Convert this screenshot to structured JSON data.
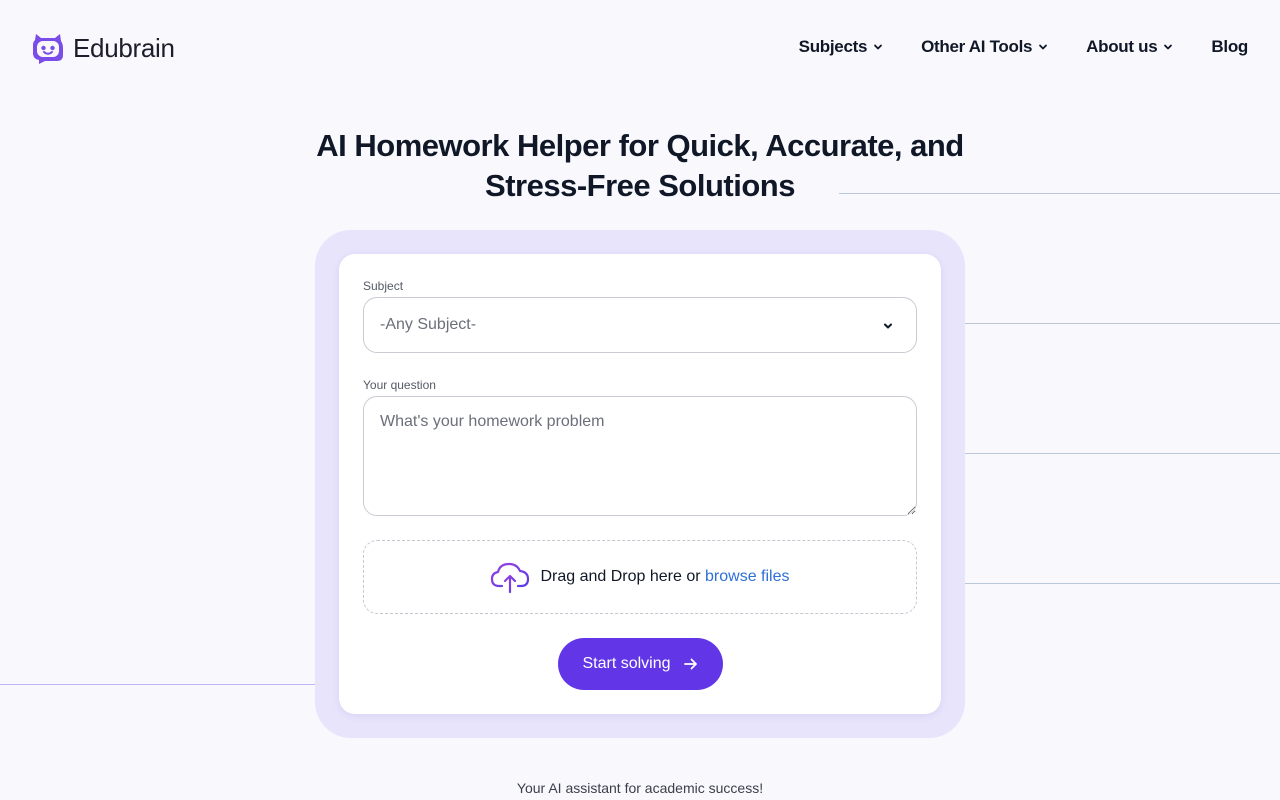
{
  "brand": {
    "name": "Edubrain",
    "accent": "#6236e7",
    "logo_icon": "robot-face-icon"
  },
  "nav": {
    "items": [
      {
        "label": "Subjects",
        "has_dropdown": true
      },
      {
        "label": "Other AI Tools",
        "has_dropdown": true
      },
      {
        "label": "About us",
        "has_dropdown": true
      },
      {
        "label": "Blog",
        "has_dropdown": false
      }
    ]
  },
  "hero": {
    "title_line1": "AI Homework Helper for Quick, Accurate, and",
    "title_line2": "Stress-Free Solutions"
  },
  "form": {
    "subject_label": "Subject",
    "subject_value": "-Any Subject-",
    "question_label": "Your question",
    "question_placeholder": "What's your homework problem",
    "dropzone_text": "Drag and Drop here or ",
    "dropzone_link": "browse files",
    "dropzone_icon": "cloud-upload-icon",
    "submit_label": "Start solving",
    "submit_icon": "arrow-right-icon"
  },
  "tagline": "Your AI assistant for academic success!"
}
